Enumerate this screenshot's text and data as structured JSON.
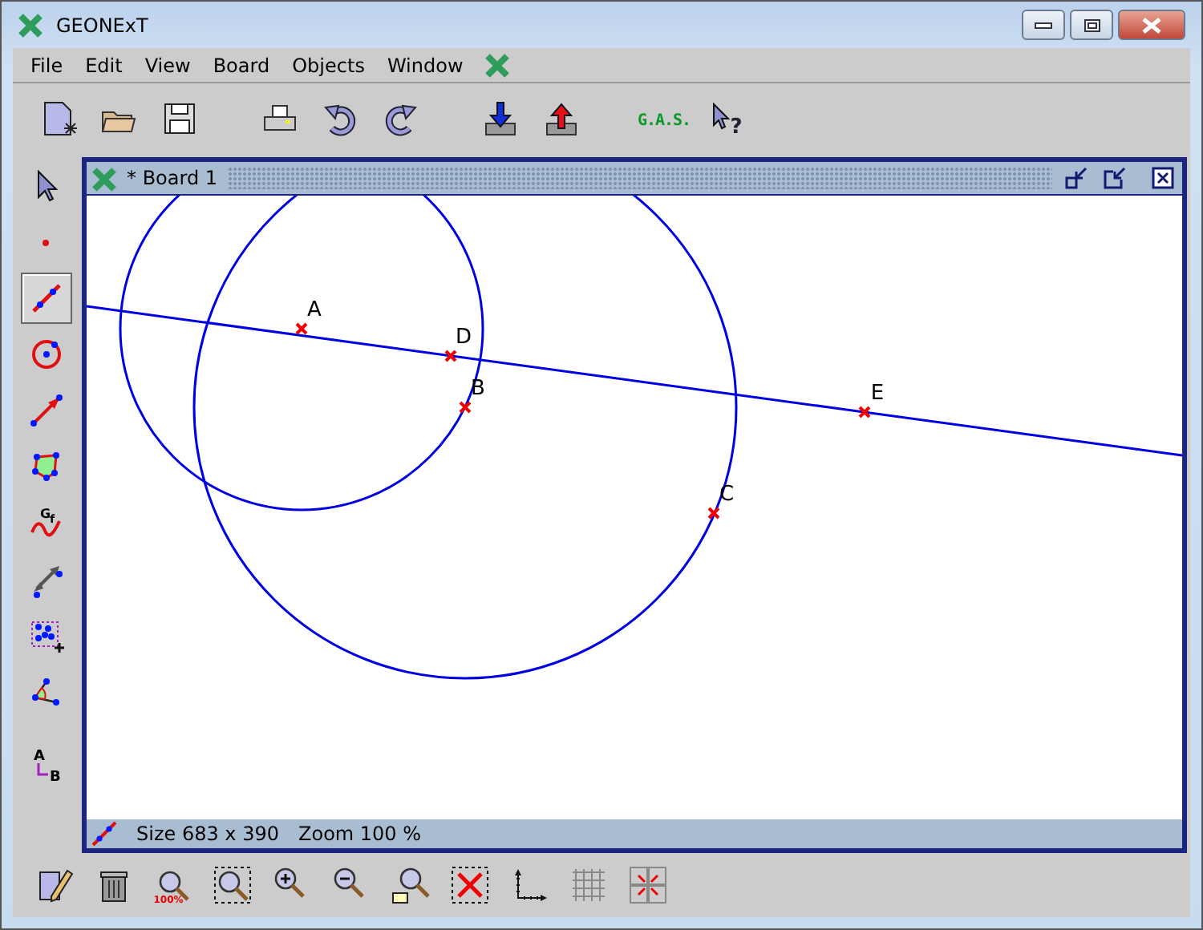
{
  "window": {
    "title": "GEONExT"
  },
  "menu": [
    {
      "label": "File"
    },
    {
      "label": "Edit"
    },
    {
      "label": "View"
    },
    {
      "label": "Board"
    },
    {
      "label": "Objects"
    },
    {
      "label": "Window"
    }
  ],
  "toolbar": [
    {
      "kind": "new"
    },
    {
      "kind": "open"
    },
    {
      "kind": "save"
    },
    {
      "kind": "gap"
    },
    {
      "kind": "print"
    },
    {
      "kind": "undo"
    },
    {
      "kind": "redo"
    },
    {
      "kind": "gap"
    },
    {
      "kind": "import"
    },
    {
      "kind": "export"
    },
    {
      "kind": "gap"
    },
    {
      "kind": "gas",
      "text": "G.A.S."
    },
    {
      "kind": "help",
      "text": "?"
    }
  ],
  "tools": [
    {
      "kind": "pointer",
      "selected": false
    },
    {
      "kind": "point",
      "selected": false
    },
    {
      "kind": "line",
      "selected": true
    },
    {
      "kind": "circle",
      "selected": false
    },
    {
      "kind": "vector",
      "selected": false
    },
    {
      "kind": "polygon",
      "selected": false
    },
    {
      "kind": "graph",
      "letters": [
        "G",
        "f"
      ],
      "selected": false
    },
    {
      "kind": "distance",
      "selected": false
    },
    {
      "kind": "group",
      "selected": false
    },
    {
      "kind": "angle",
      "selected": false
    },
    {
      "kind": "text",
      "letters": [
        "A",
        "B"
      ],
      "selected": false
    }
  ],
  "board": {
    "title": "* Board 1",
    "points": [
      {
        "label": "A"
      },
      {
        "label": "D"
      },
      {
        "label": "B"
      },
      {
        "label": "C"
      },
      {
        "label": "E"
      }
    ],
    "status": [
      "Size 683 x 390",
      "Zoom 100 %"
    ]
  },
  "bottom_toolbar": [
    {
      "kind": "edit"
    },
    {
      "kind": "delete"
    },
    {
      "kind": "zoom100",
      "text": "100%"
    },
    {
      "kind": "zoombox"
    },
    {
      "kind": "zoomin"
    },
    {
      "kind": "zoomout"
    },
    {
      "kind": "zoomfit"
    },
    {
      "kind": "fullscreen"
    },
    {
      "kind": "axes"
    },
    {
      "kind": "grid"
    },
    {
      "kind": "snap"
    }
  ]
}
